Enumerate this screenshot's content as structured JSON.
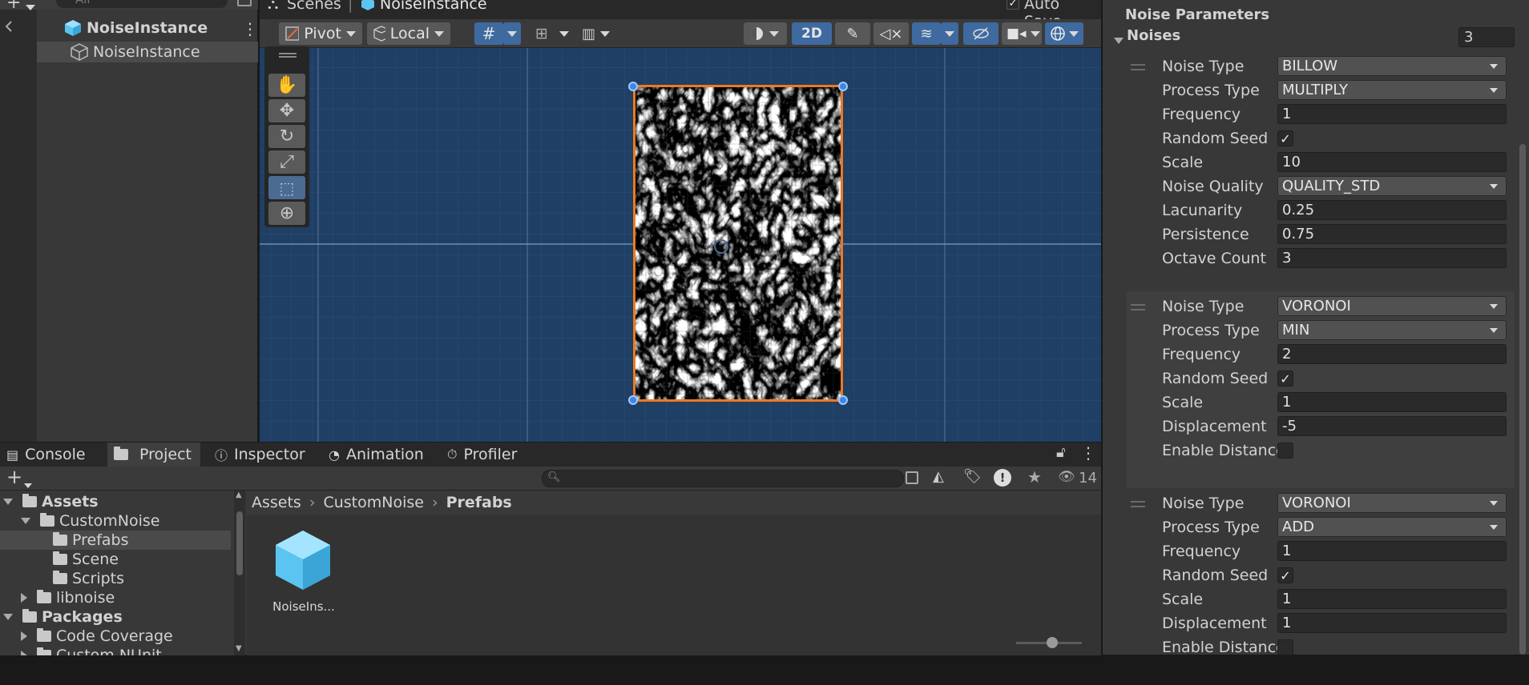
{
  "hierarchy": {
    "search_placeholder": "All",
    "items": [
      {
        "label": "NoiseInstance"
      },
      {
        "label": "NoiseInstance"
      }
    ]
  },
  "scene": {
    "breadcrumb_root": "Scenes",
    "breadcrumb_current": "NoiseInstance",
    "auto_save_label": "Auto Save",
    "auto_save_checked": true,
    "pivot_label": "Pivot",
    "local_label": "Local",
    "mode_2d_label": "2D"
  },
  "project": {
    "tabs": [
      {
        "label": "Console"
      },
      {
        "label": "Project"
      },
      {
        "label": "Inspector"
      },
      {
        "label": "Animation"
      },
      {
        "label": "Profiler"
      }
    ],
    "visible_count": "14",
    "tree": [
      {
        "label": "Assets"
      },
      {
        "label": "CustomNoise"
      },
      {
        "label": "Prefabs"
      },
      {
        "label": "Scene"
      },
      {
        "label": "Scripts"
      },
      {
        "label": "libnoise"
      },
      {
        "label": "Packages"
      },
      {
        "label": "Code Coverage"
      },
      {
        "label": "Custom NUnit"
      }
    ],
    "breadcrumb": [
      "Assets",
      "CustomNoise",
      "Prefabs"
    ],
    "asset_label": "NoiseIns..."
  },
  "inspector": {
    "section_title": "Noise Parameters",
    "noises_label": "Noises",
    "noises_count": "3",
    "groups": [
      {
        "fields": [
          {
            "label": "Noise Type",
            "kind": "dropdown",
            "value": "BILLOW"
          },
          {
            "label": "Process Type",
            "kind": "dropdown",
            "value": "MULTIPLY"
          },
          {
            "label": "Frequency",
            "kind": "text",
            "value": "1"
          },
          {
            "label": "Random Seed",
            "kind": "check",
            "value": "✓"
          },
          {
            "label": "Scale",
            "kind": "text",
            "value": "10"
          },
          {
            "label": "Noise Quality",
            "kind": "dropdown",
            "value": "QUALITY_STD"
          },
          {
            "label": "Lacunarity",
            "kind": "text",
            "value": "0.25"
          },
          {
            "label": "Persistence",
            "kind": "text",
            "value": "0.75"
          },
          {
            "label": "Octave Count",
            "kind": "text",
            "value": "3"
          }
        ]
      },
      {
        "fields": [
          {
            "label": "Noise Type",
            "kind": "dropdown",
            "value": "VORONOI"
          },
          {
            "label": "Process Type",
            "kind": "dropdown",
            "value": "MIN"
          },
          {
            "label": "Frequency",
            "kind": "text",
            "value": "2"
          },
          {
            "label": "Random Seed",
            "kind": "check",
            "value": "✓"
          },
          {
            "label": "Scale",
            "kind": "text",
            "value": "1"
          },
          {
            "label": "Displacement",
            "kind": "text",
            "value": "-5"
          },
          {
            "label": "Enable Distance",
            "kind": "check",
            "value": ""
          }
        ]
      },
      {
        "fields": [
          {
            "label": "Noise Type",
            "kind": "dropdown",
            "value": "VORONOI"
          },
          {
            "label": "Process Type",
            "kind": "dropdown",
            "value": "ADD"
          },
          {
            "label": "Frequency",
            "kind": "text",
            "value": "1"
          },
          {
            "label": "Random Seed",
            "kind": "check",
            "value": "✓"
          },
          {
            "label": "Scale",
            "kind": "text",
            "value": "1"
          },
          {
            "label": "Displacement",
            "kind": "text",
            "value": "1"
          },
          {
            "label": "Enable Distance",
            "kind": "check",
            "value": ""
          }
        ]
      }
    ]
  }
}
